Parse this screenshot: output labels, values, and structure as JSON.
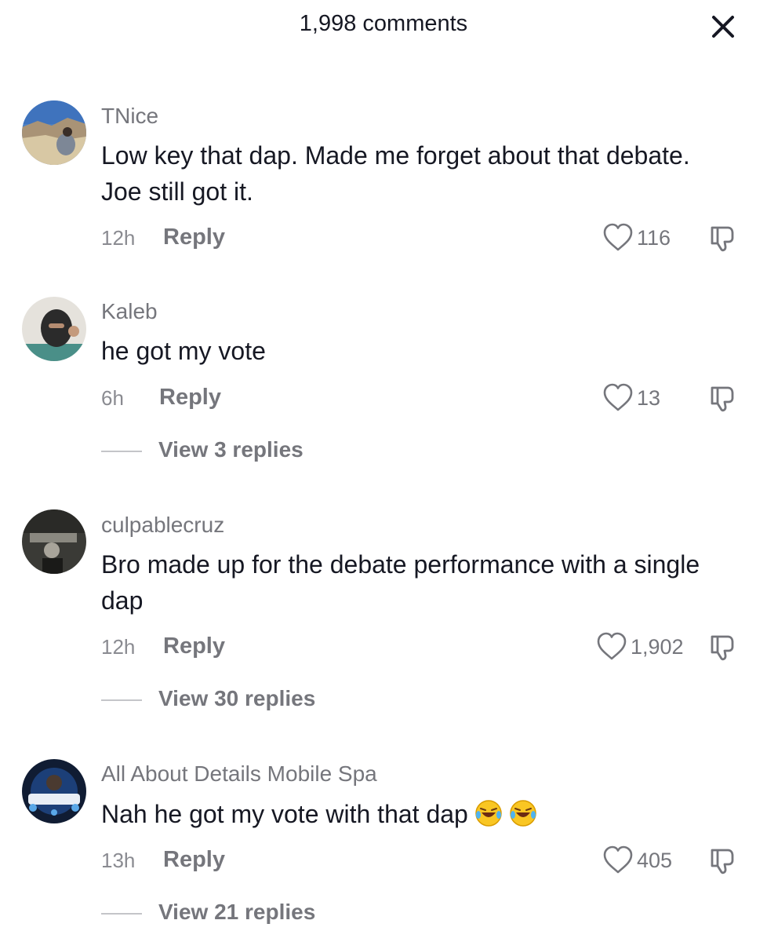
{
  "header": {
    "title": "1,998 comments",
    "close_icon": "close-icon"
  },
  "comments": [
    {
      "username": "TNice",
      "text": "Low key that dap. Made me forget about that debate. Joe still got it.",
      "time": "12h",
      "reply_label": "Reply",
      "likes": "116"
    },
    {
      "username": "Kaleb",
      "text": "he got my vote",
      "time": "6h",
      "reply_label": "Reply",
      "likes": "13",
      "view_replies": "View 3 replies"
    },
    {
      "username": "culpablecruz",
      "text": "Bro made up for the debate performance with a single dap",
      "time": "12h",
      "reply_label": "Reply",
      "likes": "1,902",
      "view_replies": "View 30 replies"
    },
    {
      "username": "All About Details Mobile Spa",
      "text": "Nah he got my vote with that dap",
      "emoji": "🤣🤣",
      "time": "13h",
      "reply_label": "Reply",
      "likes": "405",
      "view_replies": "View 21 replies",
      "avatar_logo_text": "ALL ABOUT DETAILS"
    }
  ],
  "colors": {
    "text": "#161823",
    "secondary": "#75767c",
    "timestamp": "#8a8b91"
  }
}
